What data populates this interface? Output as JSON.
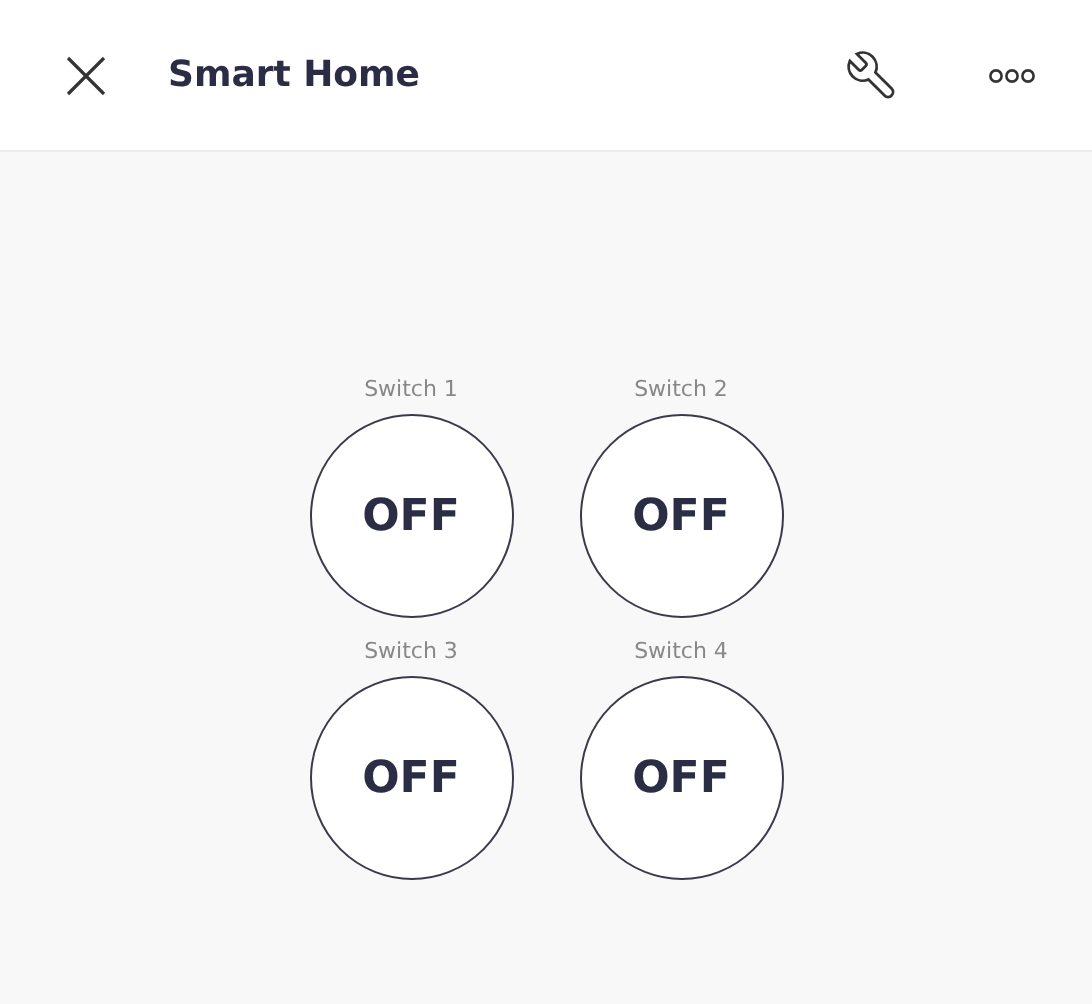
{
  "header": {
    "title": "Smart Home"
  },
  "switches": [
    {
      "label": "Switch 1",
      "state": "OFF",
      "on": false
    },
    {
      "label": "Switch 2",
      "state": "OFF",
      "on": false
    },
    {
      "label": "Switch 3",
      "state": "OFF",
      "on": false
    },
    {
      "label": "Switch 4",
      "state": "OFF",
      "on": false
    }
  ]
}
